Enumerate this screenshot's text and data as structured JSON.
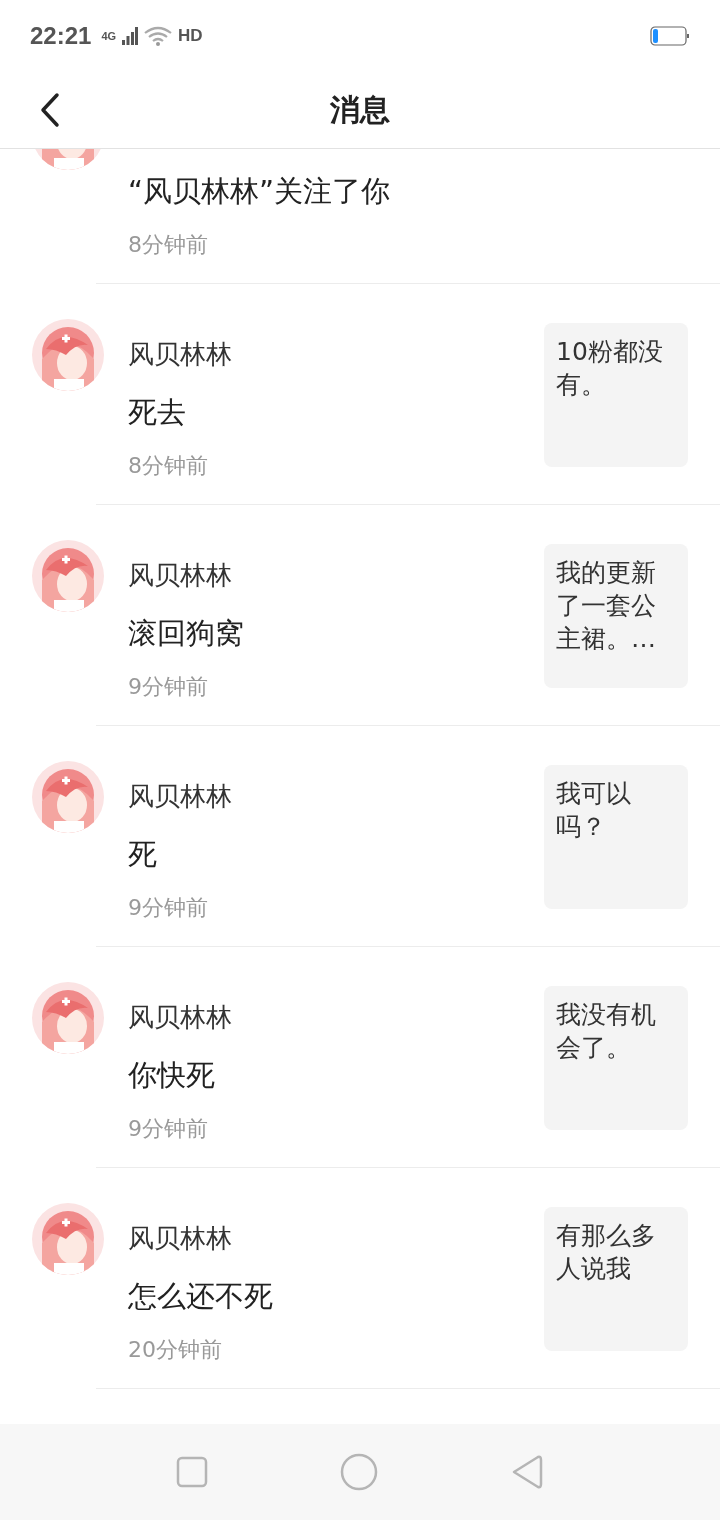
{
  "status_bar": {
    "time": "22:21",
    "network": "4G",
    "call": "HD"
  },
  "header": {
    "title": "消息"
  },
  "messages": [
    {
      "kind": "follow",
      "text": "“风贝林林”关注了你",
      "time": "8分钟前"
    },
    {
      "kind": "comment",
      "name": "风贝林林",
      "text": "死去",
      "time": "8分钟前",
      "preview": "10粉都没有。"
    },
    {
      "kind": "comment",
      "name": "风贝林林",
      "text": "滚回狗窝",
      "time": "9分钟前",
      "preview": "我的更新了一套公主裙。…"
    },
    {
      "kind": "comment",
      "name": "风贝林林",
      "text": "死",
      "time": "9分钟前",
      "preview": "我可以吗？"
    },
    {
      "kind": "comment",
      "name": "风贝林林",
      "text": "你快死",
      "time": "9分钟前",
      "preview": "我没有机会了。"
    },
    {
      "kind": "comment",
      "name": "风贝林林",
      "text": "怎么还不死",
      "time": "20分钟前",
      "preview": "有那么多人说我"
    }
  ]
}
